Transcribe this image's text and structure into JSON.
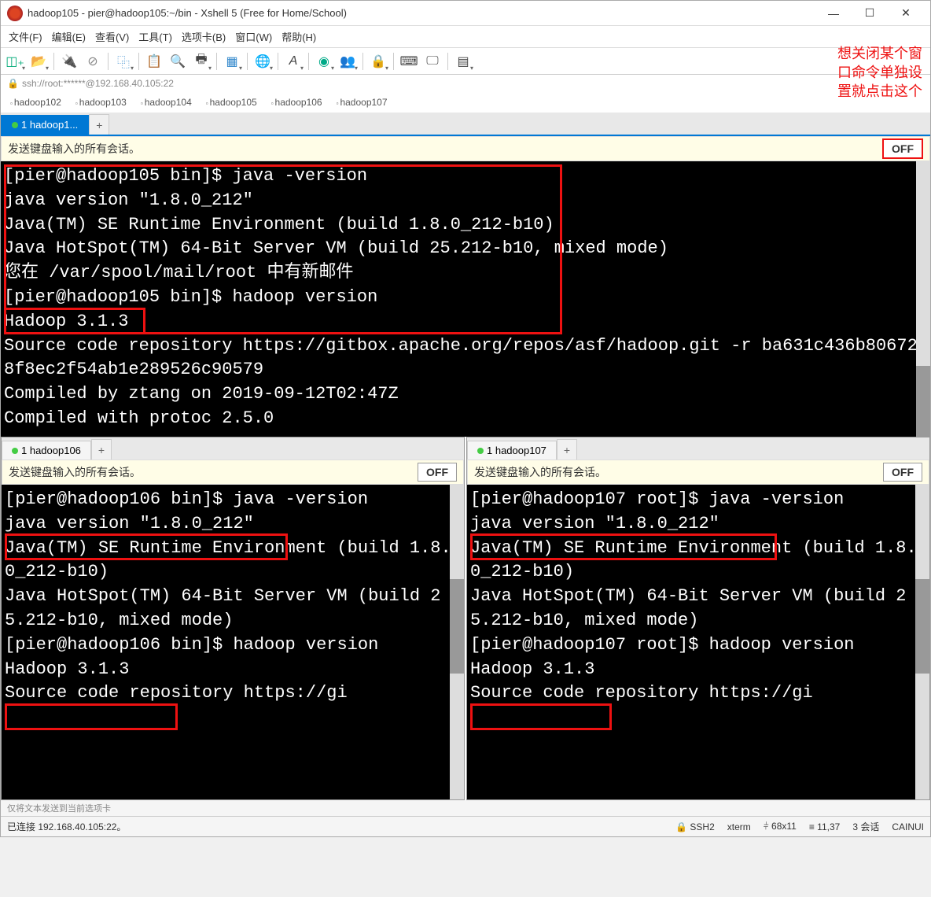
{
  "titlebar": {
    "title": "hadoop105 - pier@hadoop105:~/bin - Xshell 5 (Free for Home/School)"
  },
  "menubar": [
    "文件(F)",
    "编辑(E)",
    "查看(V)",
    "工具(T)",
    "选项卡(B)",
    "窗口(W)",
    "帮助(H)"
  ],
  "annotation": "想关闭某个窗\n口命令单独设\n置就点击这个",
  "address": "ssh://root:******@192.168.40.105:22",
  "session_tabs": [
    "hadoop102",
    "hadoop103",
    "hadoop104",
    "hadoop105",
    "hadoop106",
    "hadoop107"
  ],
  "main_tab": "1 hadoop1...",
  "broadcast": {
    "text": "发送键盘输入的所有会话。",
    "btn": "OFF"
  },
  "terminal_105": "[pier@hadoop105 bin]$ java -version\njava version \"1.8.0_212\"\nJava(TM) SE Runtime Environment (build 1.8.0_212-b10)\nJava HotSpot(TM) 64-Bit Server VM (build 25.212-b10, mixed mode)\n您在 /var/spool/mail/root 中有新邮件\n[pier@hadoop105 bin]$ hadoop version\nHadoop 3.1.3\nSource code repository https://gitbox.apache.org/repos/asf/hadoop.git -r ba631c436b806728f8ec2f54ab1e289526c90579\nCompiled by ztang on 2019-09-12T02:47Z\nCompiled with protoc 2.5.0",
  "pane_106": {
    "tab": "1 hadoop106",
    "terminal": "[pier@hadoop106 bin]$ java -version\njava version \"1.8.0_212\"\nJava(TM) SE Runtime Environment (build 1.8.0_212-b10)\nJava HotSpot(TM) 64-Bit Server VM (build 25.212-b10, mixed mode)\n[pier@hadoop106 bin]$ hadoop version\nHadoop 3.1.3\nSource code repository https://gi"
  },
  "pane_107": {
    "tab": "1 hadoop107",
    "terminal": "[pier@hadoop107 root]$ java -version\njava version \"1.8.0_212\"\nJava(TM) SE Runtime Environment (build 1.8.0_212-b10)\nJava HotSpot(TM) 64-Bit Server VM (build 25.212-b10, mixed mode)\n[pier@hadoop107 root]$ hadoop version\nHadoop 3.1.3\nSource code repository https://gi"
  },
  "status_lower": "仅将文本发送到当前选项卡",
  "statusbar": {
    "conn": "已连接 192.168.40.105:22。",
    "ssh": "SSH2",
    "term": "xterm",
    "size": "68x11",
    "pos": "11,37",
    "sessions": "3 会话",
    "ime": "CAINUI"
  }
}
